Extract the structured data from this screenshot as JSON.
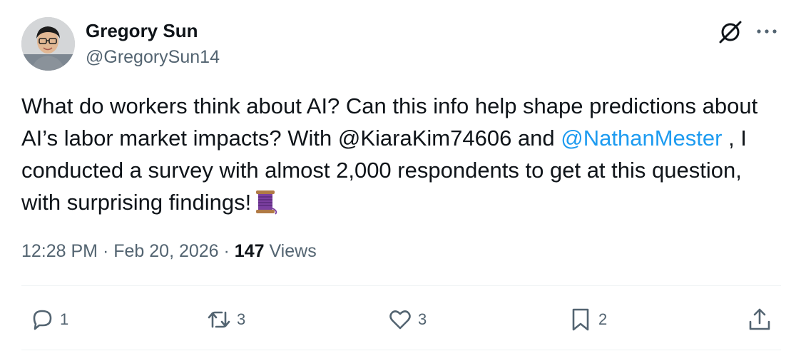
{
  "author": {
    "name": "Gregory Sun",
    "handle": "@GregorySun14"
  },
  "tweet": {
    "text_part1": "What do workers think about AI? Can this info help shape predictions about AI’s labor market impacts? With @KiaraKim74606 and ",
    "mention": "@NathanMester",
    "text_part2": " , I conducted a survey with almost 2,000 respondents to get at this question, with surprising findings!",
    "emoji": "thread-spool-icon"
  },
  "meta": {
    "time": "12:28 PM",
    "separator1": " · ",
    "date": "Feb 20, 2026",
    "separator2": " · ",
    "views_count": "147",
    "views_label": " Views"
  },
  "actions": {
    "reply_count": "1",
    "repost_count": "3",
    "like_count": "3",
    "bookmark_count": "2"
  },
  "colors": {
    "accent": "#1d9bf0",
    "text_primary": "#0f1419",
    "text_secondary": "#536471",
    "emoji_purple": "#7b3fa0"
  },
  "icons": [
    "grok-icon",
    "more-icon",
    "reply-icon",
    "repost-icon",
    "like-icon",
    "bookmark-icon",
    "share-icon"
  ]
}
